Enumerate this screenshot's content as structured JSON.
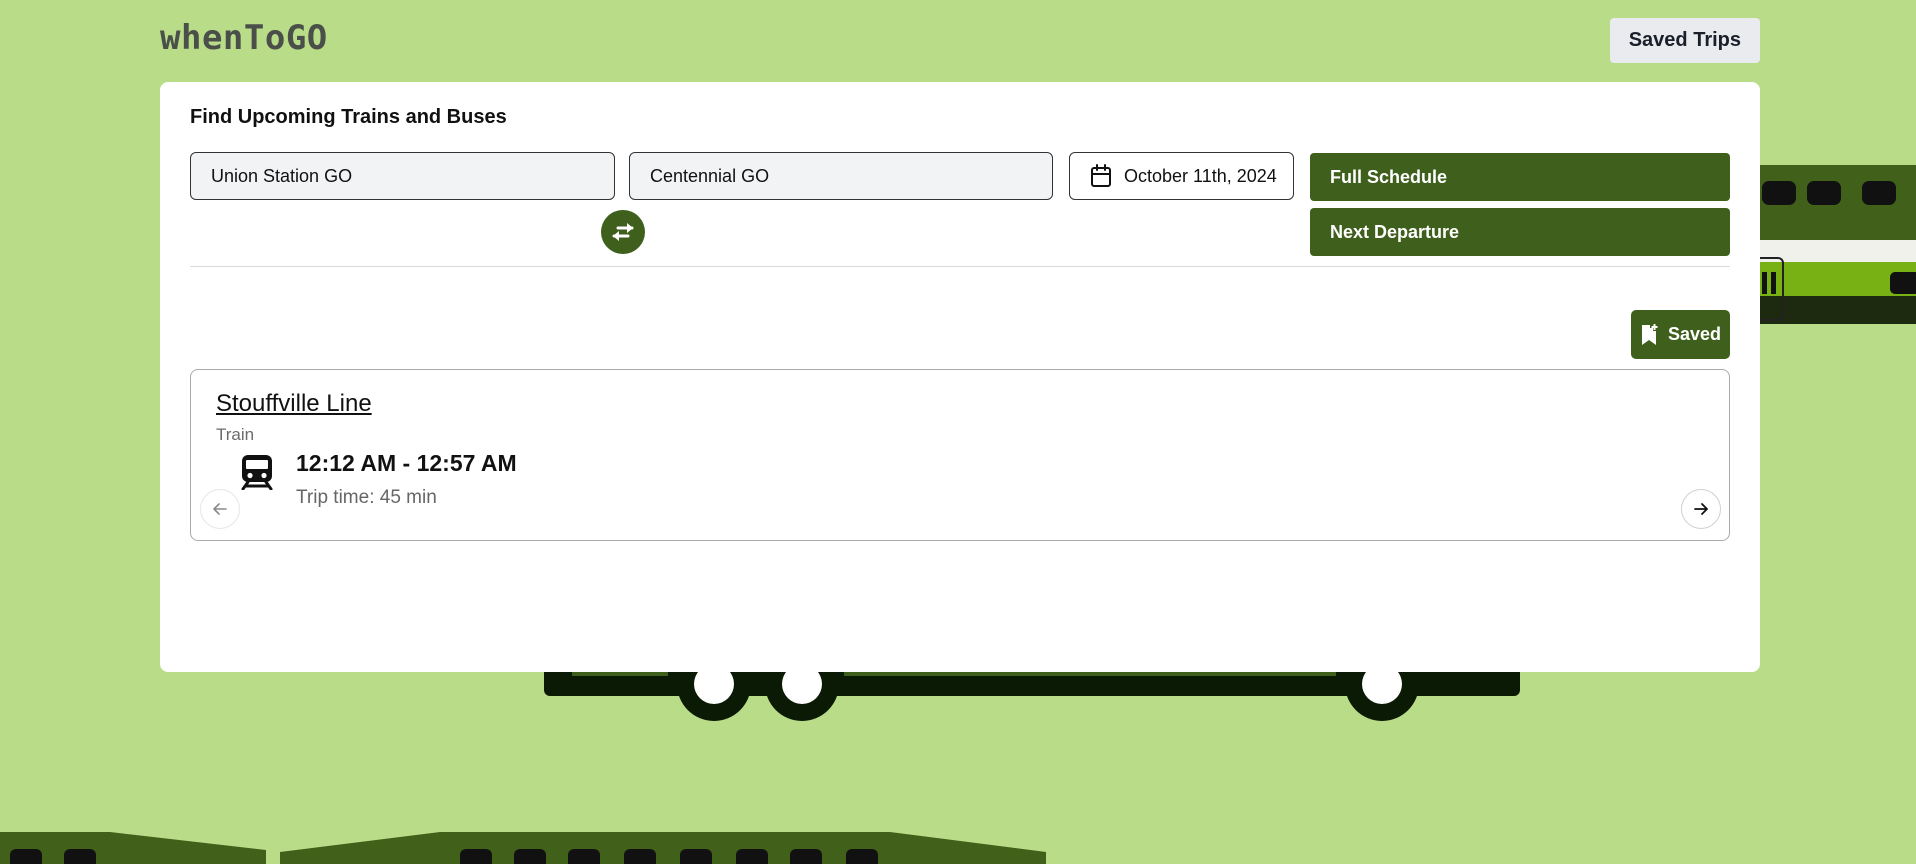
{
  "app": {
    "logo": "whenToGO",
    "saved_trips_label": "Saved Trips"
  },
  "search": {
    "title": "Find Upcoming Trains and Buses",
    "from_value": "Union Station GO",
    "to_value": "Centennial GO",
    "date_value": "October 11th, 2024",
    "full_schedule_label": "Full Schedule",
    "next_departure_label": "Next Departure"
  },
  "saved_button": {
    "label": "Saved"
  },
  "result": {
    "route_name": "Stouffville Line",
    "mode": "Train",
    "times": "12:12 AM - 12:57 AM",
    "trip_time": "Trip time: 45 min"
  },
  "colors": {
    "background": "#b9dc88",
    "primary": "#3f5f1d",
    "card": "#ffffff"
  },
  "icons": [
    "calendar-icon",
    "swap-icon",
    "bookmark-plus-icon",
    "train-icon",
    "arrow-left-icon",
    "arrow-right-icon"
  ]
}
